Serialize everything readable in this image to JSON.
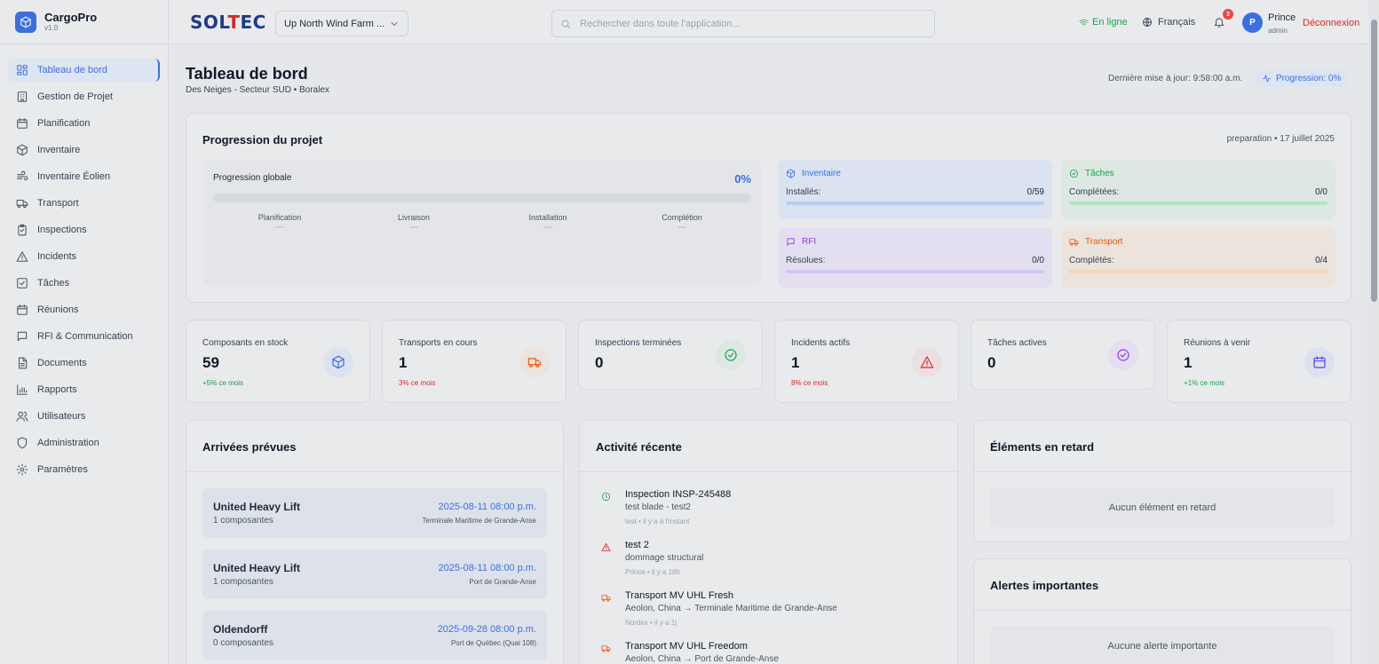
{
  "app": {
    "name": "CargoPro",
    "version": "v1.0"
  },
  "sidebar": {
    "items": [
      {
        "label": "Tableau de bord",
        "icon": "dashboard-icon",
        "active": true
      },
      {
        "label": "Gestion de Projet",
        "icon": "building-icon"
      },
      {
        "label": "Planification",
        "icon": "calendar-icon"
      },
      {
        "label": "Inventaire",
        "icon": "box-icon"
      },
      {
        "label": "Inventaire Éolien",
        "icon": "wind-icon"
      },
      {
        "label": "Transport",
        "icon": "truck-icon"
      },
      {
        "label": "Inspections",
        "icon": "clipboard-icon"
      },
      {
        "label": "Incidents",
        "icon": "warning-icon"
      },
      {
        "label": "Tâches",
        "icon": "checkbox-icon"
      },
      {
        "label": "Réunions",
        "icon": "calendar-icon"
      },
      {
        "label": "RFI & Communication",
        "icon": "chat-icon"
      },
      {
        "label": "Documents",
        "icon": "document-icon"
      },
      {
        "label": "Rapports",
        "icon": "bar-chart-icon"
      },
      {
        "label": "Utilisateurs",
        "icon": "users-icon"
      },
      {
        "label": "Administration",
        "icon": "shield-icon"
      },
      {
        "label": "Paramètres",
        "icon": "gear-icon"
      }
    ]
  },
  "header": {
    "logo_left": "SOL",
    "logo_red": "T",
    "logo_right": "EC",
    "project": "Up North Wind Farm ...",
    "search_placeholder": "Rechercher dans toute l'application...",
    "status": "En ligne",
    "language": "Français",
    "notifications": "3",
    "user_initial": "P",
    "user_name": "Prince",
    "user_role": "admin",
    "logout": "Déconnexion"
  },
  "page": {
    "title": "Tableau de bord",
    "subtitle": "Des Neiges - Secteur SUD • Boralex",
    "last_update": "Dernière mise à jour: 9:58:00 a.m.",
    "progress_pill": "Progression: 0%"
  },
  "progress": {
    "title": "Progression du projet",
    "phase": "preparation • 17 juillet 2025",
    "global_label": "Progression globale",
    "global_value": "0%",
    "global_fraction": 0,
    "phases": [
      "Planification",
      "Livraison",
      "Installation",
      "Complétion"
    ],
    "cards": [
      {
        "title": "Inventaire",
        "key": "Installés:",
        "value": "0/59",
        "fraction": 0,
        "icon": "box-icon",
        "color": "#3b6fe0",
        "bg": "#dbe3f0",
        "track": "#b8cdf3"
      },
      {
        "title": "Tâches",
        "key": "Complétées:",
        "value": "0/0",
        "fraction": 0,
        "icon": "check-circle-icon",
        "color": "#16a34a",
        "bg": "#dde8e2",
        "track": "#b5e3c6"
      },
      {
        "title": "RFI",
        "key": "Résolues:",
        "value": "0/0",
        "fraction": 0,
        "icon": "chat-icon",
        "color": "#9333ea",
        "bg": "#e3dff0",
        "track": "#d6c6f3"
      },
      {
        "title": "Transport",
        "key": "Complétés:",
        "value": "0/4",
        "fraction": 0,
        "icon": "truck-icon",
        "color": "#ea580c",
        "bg": "#ebe3dc",
        "track": "#f3d6b6"
      }
    ]
  },
  "stats": [
    {
      "label": "Composants en stock",
      "value": "59",
      "trend": "+5% ce mois",
      "trend_color": "#16a34a",
      "icon": "box-icon",
      "color": "#3b6fe0",
      "bg": "#dbe3f0"
    },
    {
      "label": "Transports en cours",
      "value": "1",
      "trend": "3% ce mois",
      "trend_color": "#dc2626",
      "icon": "truck-icon",
      "color": "#ea580c",
      "bg": "#ebe3dc"
    },
    {
      "label": "Inspections terminées",
      "value": "0",
      "trend": "",
      "trend_color": "#16a34a",
      "icon": "check-circle-icon",
      "color": "#16a34a",
      "bg": "#dde8e2"
    },
    {
      "label": "Incidents actifs",
      "value": "1",
      "trend": "8% ce mois",
      "trend_color": "#dc2626",
      "icon": "warning-icon",
      "color": "#dc2626",
      "bg": "#ebdfe1"
    },
    {
      "label": "Tâches actives",
      "value": "0",
      "trend": "",
      "trend_color": "#16a34a",
      "icon": "check-circle-icon",
      "color": "#9333ea",
      "bg": "#e3dff0"
    },
    {
      "label": "Réunions à venir",
      "value": "1",
      "trend": "+1% ce mois",
      "trend_color": "#16a34a",
      "icon": "calendar-icon",
      "color": "#4f46e5",
      "bg": "#dde0f0"
    }
  ],
  "arrivals": {
    "title": "Arrivées prévues",
    "items": [
      {
        "name": "United Heavy Lift",
        "count": "1 composantes",
        "date": "2025-08-11 08:00 p.m.",
        "location": "Terminale Maritime de Grande-Anse"
      },
      {
        "name": "United Heavy Lift",
        "count": "1 composantes",
        "date": "2025-08-11 08:00 p.m.",
        "location": "Port de Grande-Anse"
      },
      {
        "name": "Oldendorff",
        "count": "0 composantes",
        "date": "2025-09-28 08:00 p.m.",
        "location": "Port de Québec (Quai 108)"
      }
    ]
  },
  "activity": {
    "title": "Activité récente",
    "items": [
      {
        "title": "Inspection INSP-245488",
        "desc": "test blade - test2",
        "meta": "test • il y a à l'instant",
        "icon": "clock-icon",
        "color": "#16a34a"
      },
      {
        "title": "test 2",
        "desc": "dommage structural",
        "meta": "Prince • il y a 18h",
        "icon": "warning-icon",
        "color": "#dc2626"
      },
      {
        "title": "Transport MV UHL Fresh",
        "desc": "Aeolon, China → Terminale Maritime de Grande-Anse",
        "meta": "Nordex • il y a 1j",
        "icon": "truck-icon",
        "color": "#ea580c"
      },
      {
        "title": "Transport MV UHL Freedom",
        "desc": "Aeolon, China → Port de Grande-Anse",
        "meta": "",
        "icon": "truck-icon",
        "color": "#ea580c"
      }
    ]
  },
  "late": {
    "title": "Éléments en retard",
    "empty": "Aucun élément en retard"
  },
  "alerts": {
    "title": "Alertes importantes",
    "empty": "Aucune alerte importante"
  }
}
